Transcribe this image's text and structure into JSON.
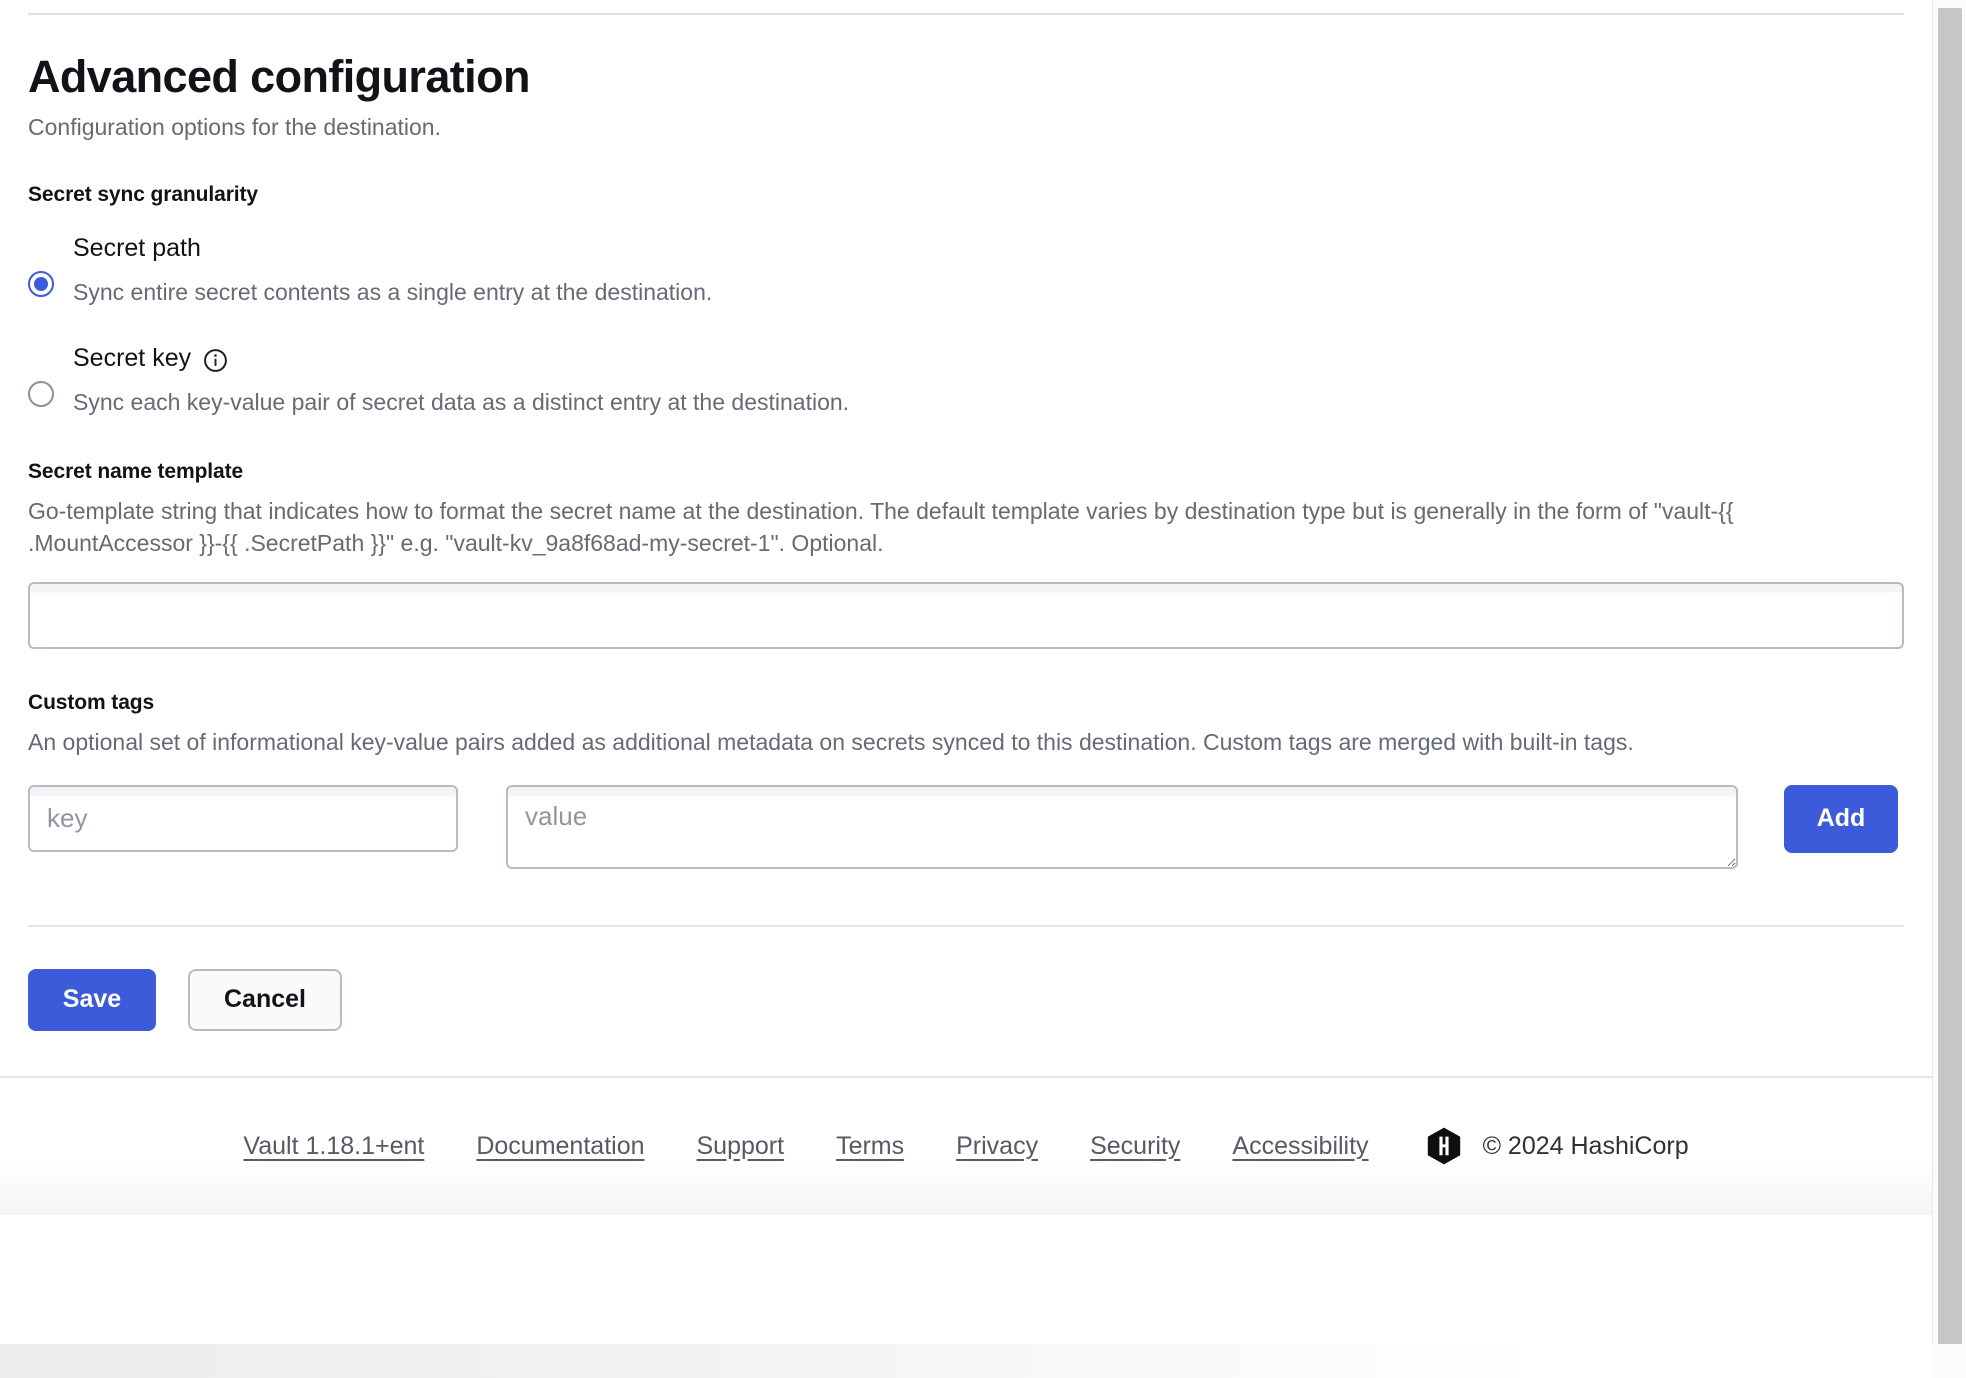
{
  "page": {
    "title": "Advanced configuration",
    "subtitle": "Configuration options for the destination."
  },
  "granularity": {
    "label": "Secret sync granularity",
    "options": [
      {
        "title": "Secret path",
        "description": "Sync entire secret contents as a single entry at the destination.",
        "selected": true,
        "has_info_icon": false
      },
      {
        "title": "Secret key",
        "description": "Sync each key-value pair of secret data as a distinct entry at the destination.",
        "selected": false,
        "has_info_icon": true,
        "info_icon": "info-circle-icon"
      }
    ]
  },
  "secret_name_template": {
    "label": "Secret name template",
    "help": "Go-template string that indicates how to format the secret name at the destination. The default template varies by destination type but is generally in the form of \"vault-{{ .MountAccessor }}-{{ .SecretPath }}\" e.g. \"vault-kv_9a8f68ad-my-secret-1\". Optional.",
    "value": "",
    "placeholder": ""
  },
  "custom_tags": {
    "label": "Custom tags",
    "help": "An optional set of informational key-value pairs added as additional metadata on secrets synced to this destination. Custom tags are merged with built-in tags.",
    "key_value": "",
    "key_placeholder": "key",
    "value_value": "",
    "value_placeholder": "value",
    "add_label": "Add"
  },
  "actions": {
    "save_label": "Save",
    "cancel_label": "Cancel"
  },
  "footer": {
    "links": [
      "Vault 1.18.1+ent",
      "Documentation",
      "Support",
      "Terms",
      "Privacy",
      "Security",
      "Accessibility"
    ],
    "logo": "hashicorp-logo-icon",
    "copyright": "© 2024 HashiCorp"
  },
  "colors": {
    "accent": "#3b5bdb",
    "text": "#111318",
    "muted": "#656a76",
    "border": "#b7bbc5"
  }
}
